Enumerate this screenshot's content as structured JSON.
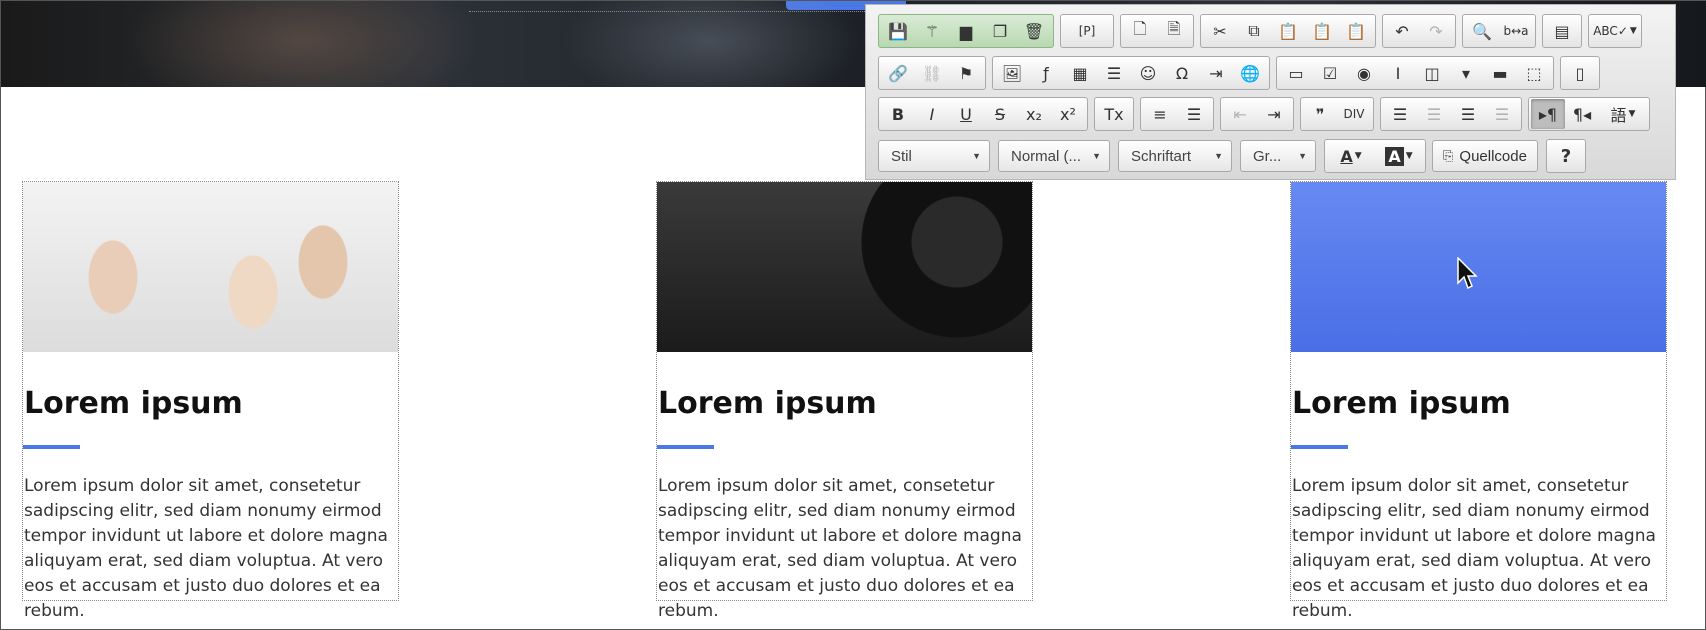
{
  "toolbar": {
    "row1": [
      {
        "group": "document-actions",
        "green": true,
        "buttons": [
          {
            "icon": "save-icon",
            "glyph": "💾"
          },
          {
            "icon": "magic-wand-icon",
            "glyph": "⚚"
          },
          {
            "icon": "folder-icon",
            "glyph": "▆"
          },
          {
            "icon": "copy-icon",
            "glyph": "❐"
          },
          {
            "icon": "trash-icon",
            "glyph": "🗑"
          }
        ]
      },
      {
        "group": "placeholder",
        "buttons": [
          {
            "icon": "placeholder-p-icon",
            "glyph": "[P]",
            "wide": true
          }
        ]
      },
      {
        "group": "page",
        "buttons": [
          {
            "icon": "new-page-icon",
            "glyph": "🗋"
          },
          {
            "icon": "templates-icon",
            "glyph": "🗎"
          }
        ]
      },
      {
        "group": "clipboard",
        "buttons": [
          {
            "icon": "cut-icon",
            "glyph": "✂"
          },
          {
            "icon": "copy-icon",
            "glyph": "⧉"
          },
          {
            "icon": "paste-icon",
            "glyph": "📋"
          },
          {
            "icon": "paste-text-icon",
            "glyph": "📋"
          },
          {
            "icon": "paste-word-icon",
            "glyph": "📋"
          }
        ]
      },
      {
        "group": "history",
        "buttons": [
          {
            "icon": "undo-icon",
            "glyph": "↶"
          },
          {
            "icon": "redo-icon",
            "glyph": "↷",
            "disabled": true
          }
        ]
      },
      {
        "group": "find",
        "buttons": [
          {
            "icon": "find-icon",
            "glyph": "🔍"
          },
          {
            "icon": "replace-icon",
            "glyph": "b↔a"
          }
        ]
      },
      {
        "group": "select-all",
        "buttons": [
          {
            "icon": "select-all-icon",
            "glyph": "▤"
          }
        ]
      },
      {
        "group": "spellcheck",
        "buttons": [
          {
            "icon": "spellcheck-icon",
            "glyph": "ABC✓",
            "wide": true,
            "caret": true
          }
        ]
      }
    ],
    "row2": [
      {
        "group": "links",
        "buttons": [
          {
            "icon": "link-icon",
            "glyph": "🔗"
          },
          {
            "icon": "unlink-icon",
            "glyph": "⛓",
            "disabled": true
          },
          {
            "icon": "anchor-flag-icon",
            "glyph": "⚑"
          }
        ]
      },
      {
        "group": "insert",
        "buttons": [
          {
            "icon": "image-icon",
            "glyph": "🖼"
          },
          {
            "icon": "flash-icon",
            "glyph": "ƒ"
          },
          {
            "icon": "table-icon",
            "glyph": "▦"
          },
          {
            "icon": "horizontal-line-icon",
            "glyph": "☰"
          },
          {
            "icon": "smiley-icon",
            "glyph": "☺"
          },
          {
            "icon": "special-char-icon",
            "glyph": "Ω"
          },
          {
            "icon": "page-break-icon",
            "glyph": "⇥"
          },
          {
            "icon": "iframe-icon",
            "glyph": "🌐"
          }
        ]
      },
      {
        "group": "forms",
        "buttons": [
          {
            "icon": "form-icon",
            "glyph": "▭"
          },
          {
            "icon": "checkbox-icon",
            "glyph": "☑"
          },
          {
            "icon": "radio-icon",
            "glyph": "◉"
          },
          {
            "icon": "textfield-icon",
            "glyph": "I"
          },
          {
            "icon": "textarea-icon",
            "glyph": "◫"
          },
          {
            "icon": "select-icon",
            "glyph": "▾"
          },
          {
            "icon": "button-icon",
            "glyph": "▬"
          },
          {
            "icon": "hidden-field-icon",
            "glyph": "⬚"
          }
        ]
      },
      {
        "group": "show-blocks",
        "buttons": [
          {
            "icon": "show-blocks-icon",
            "glyph": "▯"
          }
        ]
      }
    ],
    "row3": [
      {
        "group": "basic-styles",
        "buttons": [
          {
            "icon": "bold-icon",
            "glyph": "B"
          },
          {
            "icon": "italic-icon",
            "glyph": "I"
          },
          {
            "icon": "underline-icon",
            "glyph": "U"
          },
          {
            "icon": "strikethrough-icon",
            "glyph": "S"
          },
          {
            "icon": "subscript-icon",
            "glyph": "x₂"
          },
          {
            "icon": "superscript-icon",
            "glyph": "x²"
          }
        ]
      },
      {
        "group": "remove-format",
        "buttons": [
          {
            "icon": "remove-format-icon",
            "glyph": "Tx"
          }
        ]
      },
      {
        "group": "lists",
        "buttons": [
          {
            "icon": "numbered-list-icon",
            "glyph": "≡"
          },
          {
            "icon": "bulleted-list-icon",
            "glyph": "☰"
          }
        ]
      },
      {
        "group": "indent",
        "buttons": [
          {
            "icon": "outdent-icon",
            "glyph": "⇤",
            "disabled": true
          },
          {
            "icon": "indent-icon",
            "glyph": "⇥"
          }
        ]
      },
      {
        "group": "blocks",
        "buttons": [
          {
            "icon": "blockquote-icon",
            "glyph": "❞"
          },
          {
            "icon": "div-container-icon",
            "glyph": "DIV"
          }
        ]
      },
      {
        "group": "align",
        "buttons": [
          {
            "icon": "align-left-icon",
            "glyph": "☰"
          },
          {
            "icon": "align-center-icon",
            "glyph": "☰",
            "disabled": true
          },
          {
            "icon": "align-right-icon",
            "glyph": "☰"
          },
          {
            "icon": "justify-icon",
            "glyph": "☰",
            "disabled": true
          }
        ]
      },
      {
        "group": "direction",
        "buttons": [
          {
            "icon": "ltr-direction-icon",
            "glyph": "▸¶",
            "active": true
          },
          {
            "icon": "rtl-direction-icon",
            "glyph": "¶◂"
          },
          {
            "icon": "language-icon",
            "glyph": "語",
            "wide": true,
            "caret": true
          }
        ]
      }
    ],
    "combos": [
      {
        "name": "style-combo",
        "label": "Stil",
        "width": 112
      },
      {
        "name": "format-combo",
        "label": "Normal (...",
        "width": 112
      },
      {
        "name": "font-combo",
        "label": "Schriftart",
        "width": 114
      },
      {
        "name": "size-combo",
        "label": "Gr...",
        "width": 76
      }
    ],
    "text_color_glyph": "A",
    "bg_color_glyph": "A",
    "source_label": "Quellcode",
    "help_glyph": "?"
  },
  "cards": [
    {
      "image": "gym-group-photo",
      "title": "Lorem ipsum",
      "text": "Lorem ipsum dolor sit amet, consetetur sadipscing elitr, sed diam nonumy eirmod tempor invidunt ut labore et dolore magna aliquyam erat, sed diam voluptua. At vero eos et accusam et justo duo dolores et ea rebum."
    },
    {
      "image": "weightlifting-photo",
      "title": "Lorem ipsum",
      "text": "Lorem ipsum dolor sit amet, consetetur sadipscing elitr, sed diam nonumy eirmod tempor invidunt ut labore et dolore magna aliquyam erat, sed diam voluptua. At vero eos et accusam et justo duo dolores et ea rebum."
    },
    {
      "image": "blue-placeholder",
      "title": "Lorem ipsum",
      "text": "Lorem ipsum dolor sit amet, consetetur sadipscing elitr, sed diam nonumy eirmod tempor invidunt ut labore et dolore magna aliquyam erat, sed diam voluptua. At vero eos et accusam et justo duo dolores et ea rebum."
    }
  ],
  "colors": {
    "accent": "#4a78e6",
    "toolbar_bg": "#e3e3e3",
    "green_group": "#c7e0c1"
  }
}
